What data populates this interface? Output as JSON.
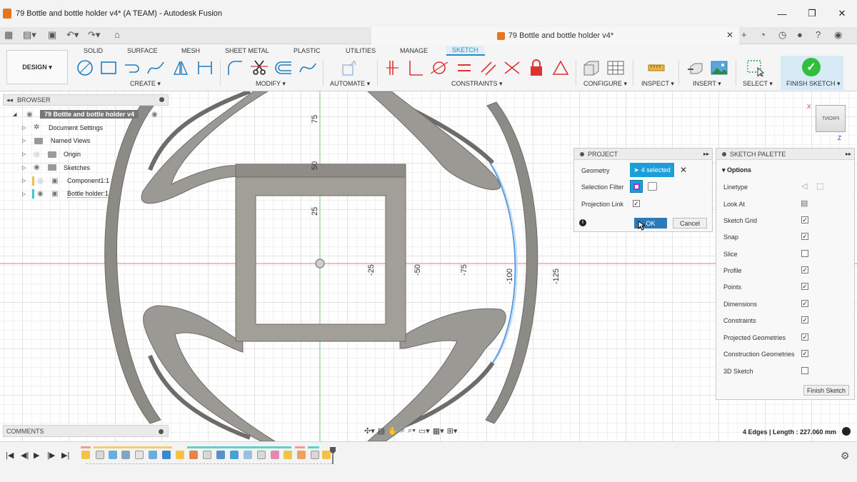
{
  "window": {
    "title": "79 Bottle and bottle holder v4* (A TEAM) - Autodesk Fusion",
    "controls": [
      "—",
      "❐",
      "✕"
    ]
  },
  "doc_tab": {
    "label": "79 Bottle and bottle holder v4*",
    "close": "✕"
  },
  "ribbon": {
    "workspace": "DESIGN ▾",
    "tabs": [
      "SOLID",
      "SURFACE",
      "MESH",
      "SHEET METAL",
      "PLASTIC",
      "UTILITIES",
      "MANAGE",
      "SKETCH"
    ],
    "active_tab": "SKETCH",
    "groups": [
      "CREATE ▾",
      "MODIFY ▾",
      "AUTOMATE ▾",
      "CONSTRAINTS ▾",
      "CONFIGURE ▾",
      "INSPECT ▾",
      "INSERT ▾",
      "SELECT ▾",
      "FINISH SKETCH ▾"
    ],
    "accent": "#1e8fc8",
    "finish_color": "#2fbf3c"
  },
  "browser": {
    "title": "BROWSER",
    "root": "79 Bottle and bottle holder v4",
    "items": [
      "Document Settings",
      "Named Views",
      "Origin",
      "Sketches",
      "Component1:1",
      "Bottle holder:1"
    ]
  },
  "comments": {
    "title": "COMMENTS"
  },
  "axis_labels": {
    "vertical": [
      "75",
      "50",
      "25"
    ],
    "horizontal": [
      "-25",
      "-50",
      "-75",
      "-100",
      "-125"
    ]
  },
  "project_dialog": {
    "title": "PROJECT",
    "geometry_label": "Geometry",
    "geometry_value": "4 selected",
    "selection_filter_label": "Selection Filter",
    "projection_link_label": "Projection Link",
    "projection_link_checked": true,
    "ok": "OK",
    "cancel": "Cancel"
  },
  "sketch_palette": {
    "title": "SKETCH PALETTE",
    "section": "Options",
    "rows": [
      {
        "label": "Linetype",
        "kind": "icons"
      },
      {
        "label": "Look At",
        "kind": "icon"
      },
      {
        "label": "Sketch Grid",
        "checked": true
      },
      {
        "label": "Snap",
        "checked": true
      },
      {
        "label": "Slice",
        "checked": false
      },
      {
        "label": "Profile",
        "checked": true
      },
      {
        "label": "Points",
        "checked": true
      },
      {
        "label": "Dimensions",
        "checked": true
      },
      {
        "label": "Constraints",
        "checked": true
      },
      {
        "label": "Projected Geometries",
        "checked": true
      },
      {
        "label": "Construction Geometries",
        "checked": true
      },
      {
        "label": "3D Sketch",
        "checked": false
      }
    ],
    "finish_button": "Finish Sketch"
  },
  "viewcube": {
    "face": "FRONT",
    "x": "X",
    "z": "Z"
  },
  "status": {
    "text": "4 Edges | Length : 227.060 mm"
  }
}
